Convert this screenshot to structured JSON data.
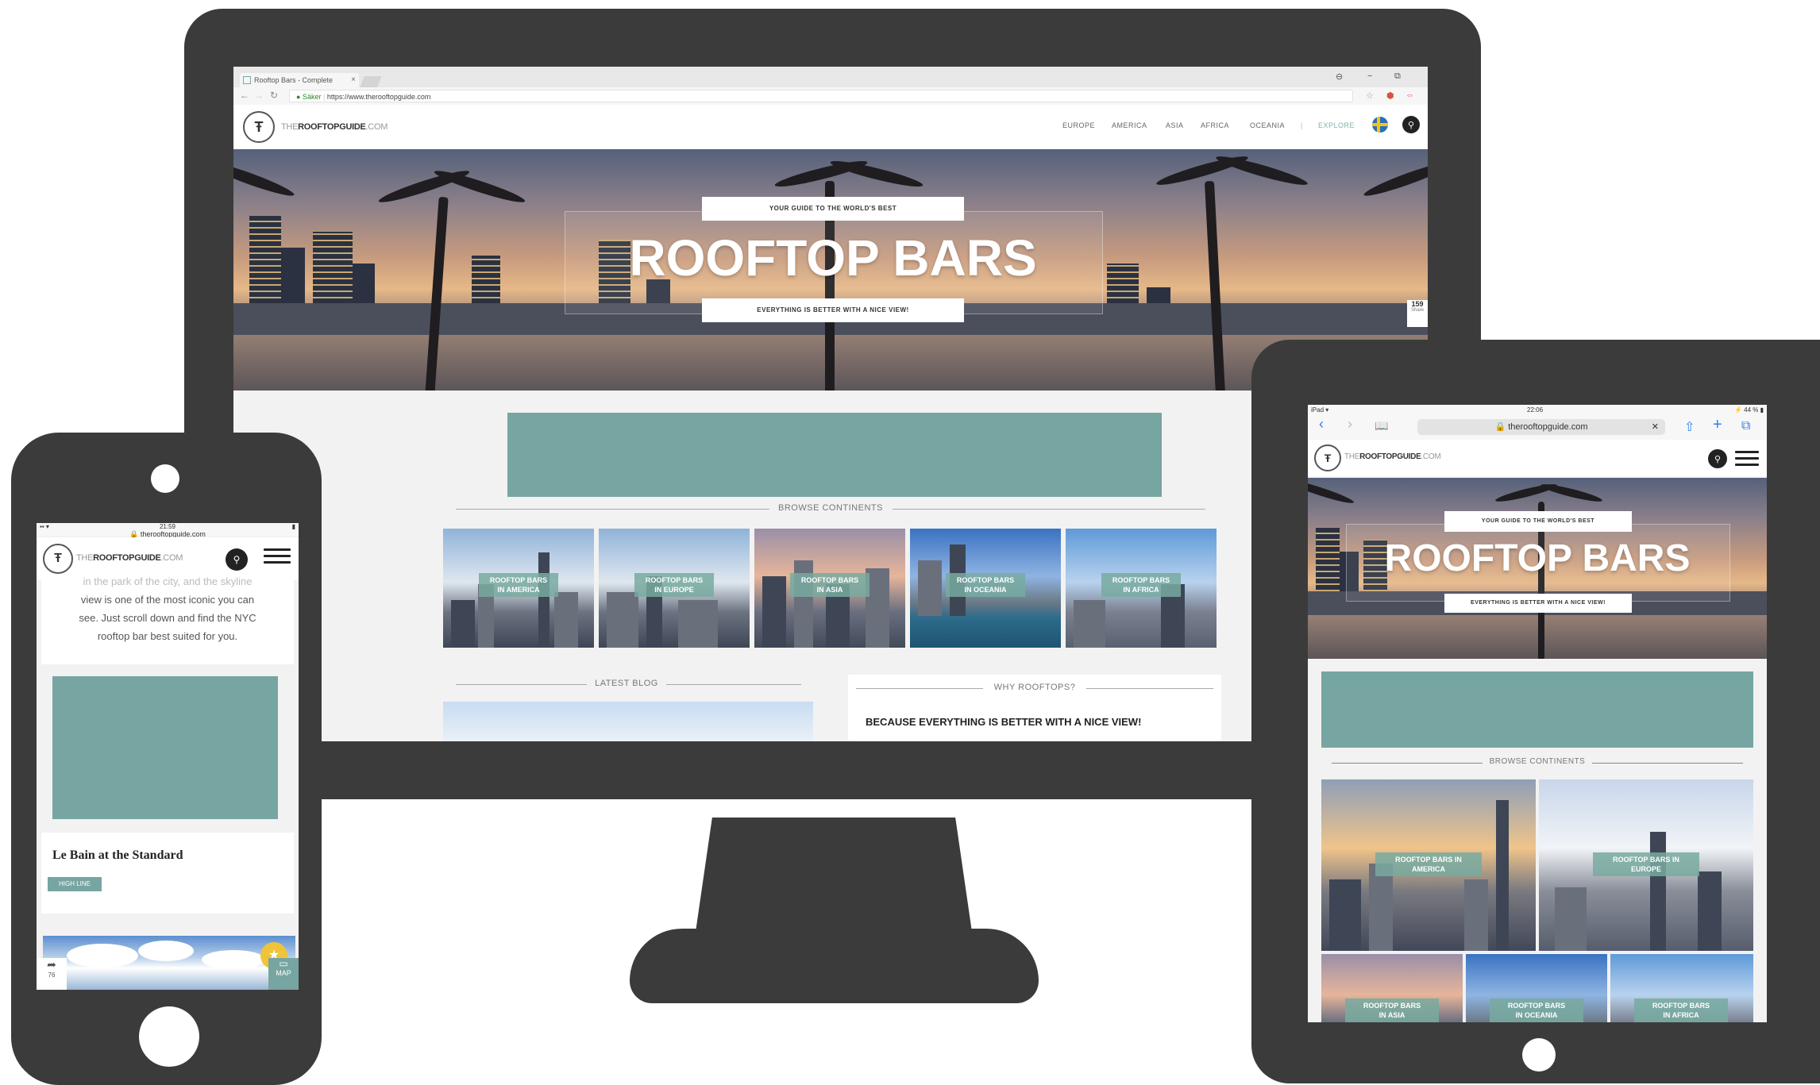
{
  "monitor": {
    "browser": {
      "tab_title": "Rooftop Bars - Complete",
      "tab_close": "×",
      "win_profile": "⊖",
      "win_minimize": "−",
      "win_restore": "⧉",
      "back": "←",
      "forward": "→",
      "reload": "↻",
      "secure_label": "● Säker",
      "url": "https://www.therooftopguide.com",
      "star_icon": "☆",
      "ext_icon": "⬢",
      "ext2_icon": "⇔"
    },
    "site": {
      "logo_mark": "Ŧ",
      "logo_prefix": "THE",
      "logo_bold": "ROOFTOPGUIDE",
      "logo_suffix": ".COM",
      "nav": [
        "EUROPE",
        "AMERICA",
        "ASIA",
        "AFRICA",
        "OCEANIA"
      ],
      "nav_divider": "|",
      "explore": "EXPLORE",
      "search_icon": "⚲",
      "hero_tag_top": "YOUR GUIDE TO THE WORLD'S BEST",
      "hero_title": "ROOFTOP BARS",
      "hero_tag_bottom": "EVERYTHING IS BETTER WITH A NICE VIEW!",
      "share_count": "159",
      "share_label": "Share",
      "browse_title": "BROWSE CONTINENTS",
      "continents": [
        {
          "label_1": "ROOFTOP BARS",
          "label_2": "IN AMERICA"
        },
        {
          "label_1": "ROOFTOP BARS",
          "label_2": "IN EUROPE"
        },
        {
          "label_1": "ROOFTOP BARS",
          "label_2": "IN ASIA"
        },
        {
          "label_1": "ROOFTOP BARS",
          "label_2": "IN OCEANIA"
        },
        {
          "label_1": "ROOFTOP BARS",
          "label_2": "IN AFRICA"
        }
      ],
      "latest_blog": "LATEST BLOG",
      "why_title": "WHY ROOFTOPS?",
      "why_headline": "BECAUSE EVERYTHING IS BETTER WITH A NICE VIEW!"
    }
  },
  "phone": {
    "status_time": "21:59",
    "status_left": "▪▪ ▾",
    "status_right": "▮",
    "url": "🔒 therooftopguide.com",
    "logo_prefix": "THE",
    "logo_bold": "ROOFTOPGUIDE",
    "logo_suffix": ".COM",
    "logo_mark": "Ŧ",
    "search_icon": "⚲",
    "body_line_0": "in the park of the city, and the skyline",
    "body_line_1": "view is one of the most iconic you can",
    "body_line_2": "see. Just scroll down and find the NYC",
    "body_line_3": "rooftop bar best suited for you.",
    "venue_name": "Le Bain at the Standard",
    "badge": "HIGH LINE",
    "share_icon": "➦",
    "share_count": "76",
    "map_icon": "▭",
    "map_label": "MAP",
    "fav_icon": "★"
  },
  "tablet": {
    "status_left": "iPad ▾",
    "status_time": "22:06",
    "status_right": "⚡ 44 % ▮",
    "back_icon": "‹",
    "forward_icon": "›",
    "bookmarks_icon": "📖",
    "url": "🔒 therooftopguide.com",
    "clear_icon": "✕",
    "share_icon": "⇧",
    "add_icon": "+",
    "tabs_icon": "⧉",
    "logo_mark": "Ŧ",
    "logo_prefix": "THE",
    "logo_bold": "ROOFTOPGUIDE",
    "logo_suffix": ".COM",
    "search_icon": "⚲",
    "hero_tag_top": "YOUR GUIDE TO THE WORLD'S BEST",
    "hero_title": "ROOFTOP BARS",
    "hero_tag_bottom": "EVERYTHING IS BETTER WITH A NICE VIEW!",
    "browse_title": "BROWSE CONTINENTS",
    "continents": [
      {
        "label_1": "ROOFTOP BARS IN",
        "label_2": "AMERICA"
      },
      {
        "label_1": "ROOFTOP BARS IN",
        "label_2": "EUROPE"
      },
      {
        "label_1": "ROOFTOP BARS",
        "label_2": "IN ASIA"
      },
      {
        "label_1": "ROOFTOP BARS",
        "label_2": "IN OCEANIA"
      },
      {
        "label_1": "ROOFTOP BARS",
        "label_2": "IN AFRICA"
      }
    ]
  },
  "colors": {
    "device": "#3b3b3b",
    "accent": "#77a5a1"
  }
}
